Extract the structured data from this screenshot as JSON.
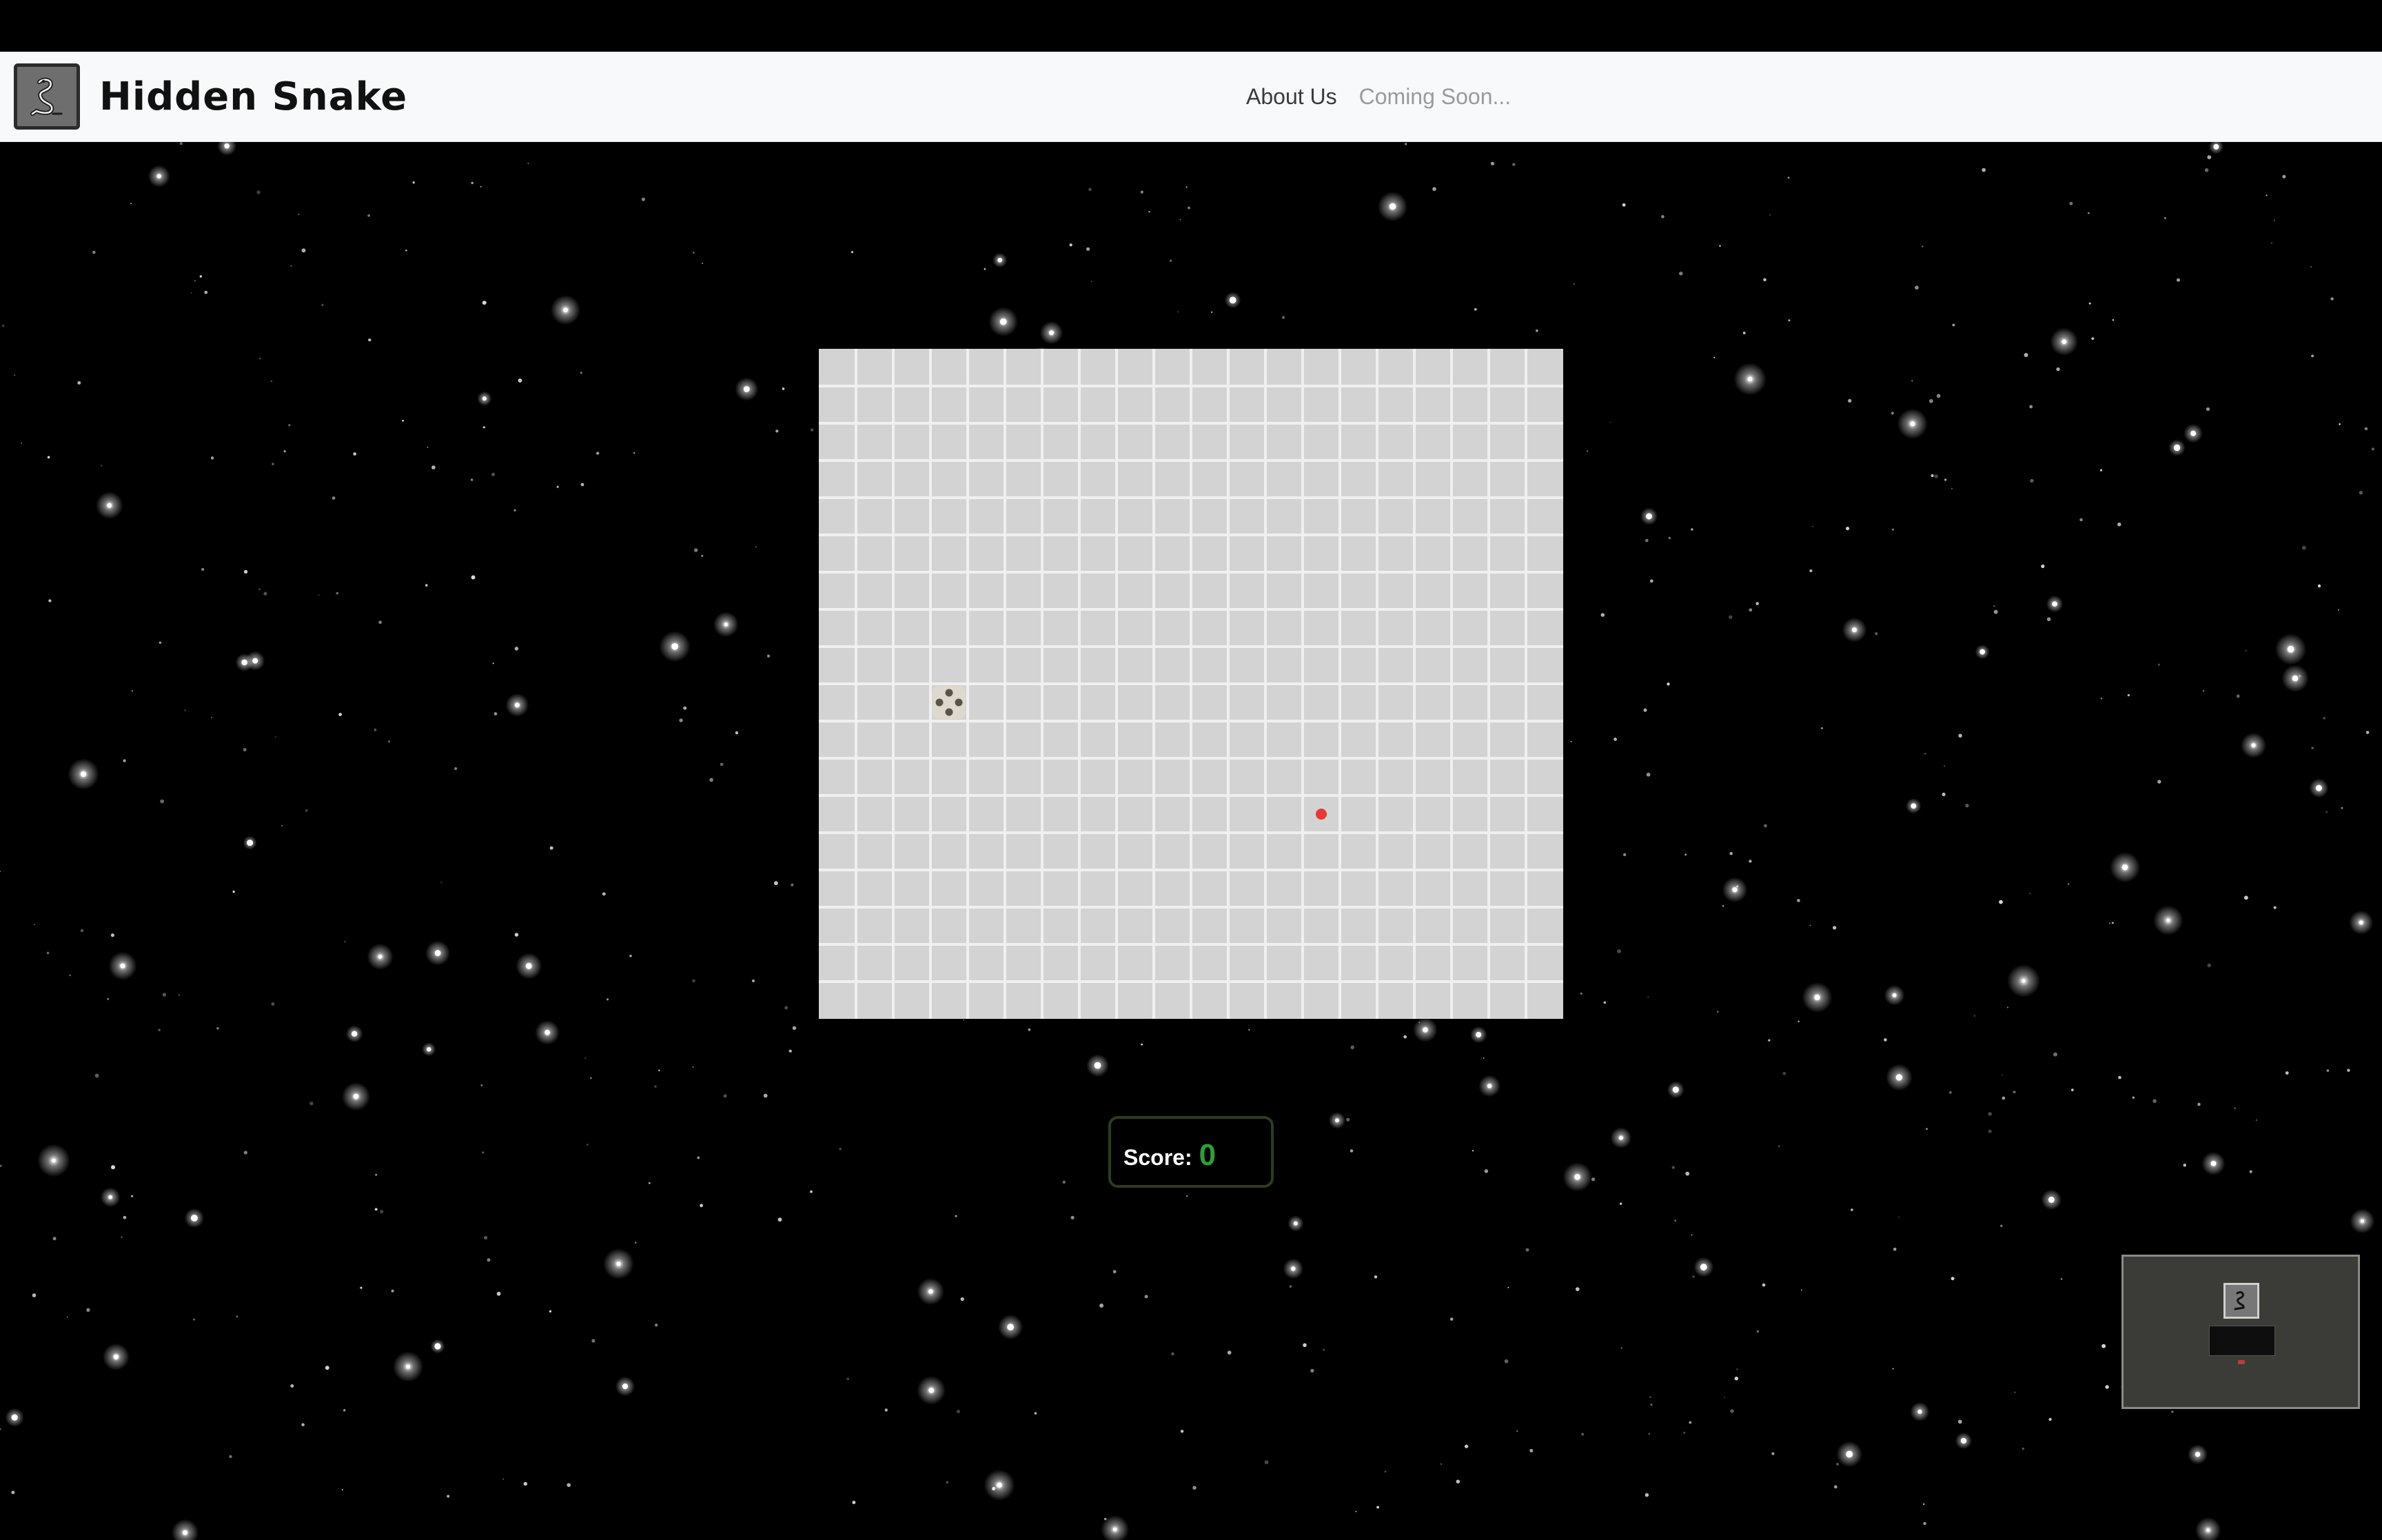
{
  "app": {
    "title": "Hidden Snake",
    "logo_icon": "snake-icon"
  },
  "nav": {
    "links": [
      {
        "label": "About Us",
        "state": "active"
      },
      {
        "label": "Coming Soon...",
        "state": "disabled"
      }
    ]
  },
  "game": {
    "grid": {
      "columns": 20,
      "rows": 18
    },
    "snake": {
      "icon": "snake-head-icon",
      "cell": [
        3,
        9
      ]
    },
    "food": {
      "icon": "food-dot-icon",
      "color": "#e53935",
      "cell": [
        13,
        12
      ]
    },
    "score": {
      "label": "Score:",
      "value": "0",
      "value_color": "#2e9e3a"
    }
  },
  "preview": {
    "icon": "page-thumbnail-icon"
  },
  "colors": {
    "background": "#000000",
    "navbar": "#f8f9fa",
    "board": "#d3d3d3",
    "grid_lines": "#f0f0f0"
  }
}
